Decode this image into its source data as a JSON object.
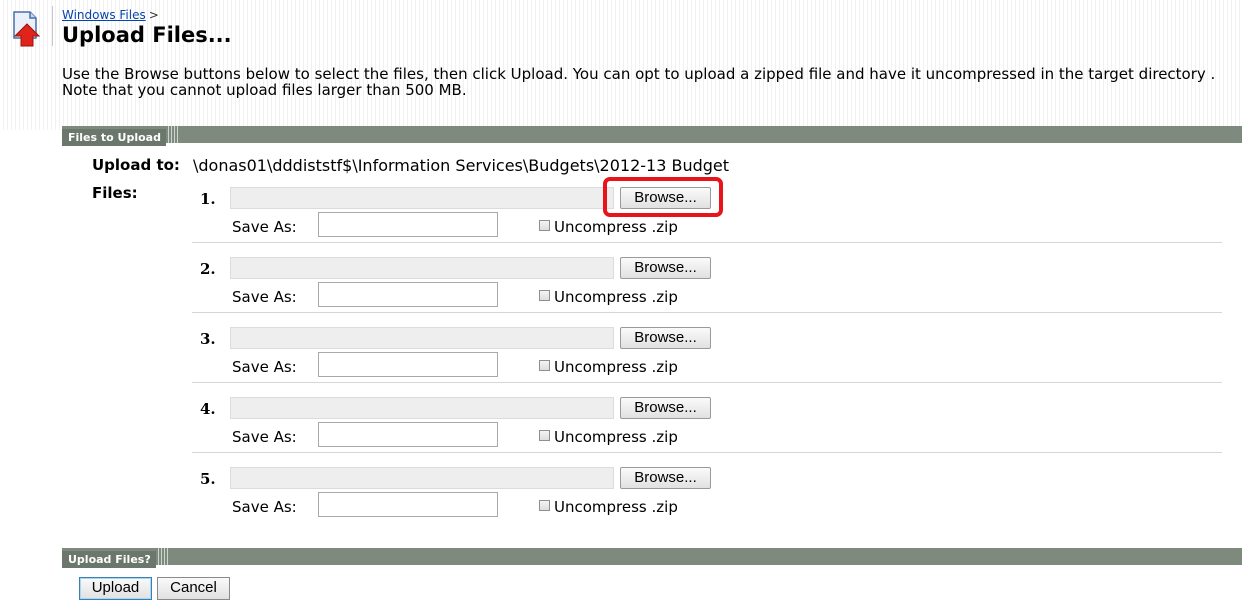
{
  "breadcrumb": {
    "link": "Windows Files",
    "separator": ">"
  },
  "page_title": "Upload Files...",
  "intro_text": "Use the Browse buttons below to select the files, then click Upload. You can opt to upload a zipped file and have it uncompressed in the target directory . Note that you cannot upload files larger than 500 MB.",
  "files_section": {
    "title": "Files to Upload",
    "upload_to_label": "Upload to:",
    "upload_to_path": "\\donas01\\dddiststf$\\Information Services\\Budgets\\2012-13 Budget",
    "files_label": "Files:",
    "rows": [
      {
        "num": "1.",
        "browse_label": "Browse...",
        "save_as_label": "Save As:",
        "save_as_value": "",
        "uncompress_label": "Uncompress .zip",
        "uncompress_checked": false
      },
      {
        "num": "2.",
        "browse_label": "Browse...",
        "save_as_label": "Save As:",
        "save_as_value": "",
        "uncompress_label": "Uncompress .zip",
        "uncompress_checked": false
      },
      {
        "num": "3.",
        "browse_label": "Browse...",
        "save_as_label": "Save As:",
        "save_as_value": "",
        "uncompress_label": "Uncompress .zip",
        "uncompress_checked": false
      },
      {
        "num": "4.",
        "browse_label": "Browse...",
        "save_as_label": "Save As:",
        "save_as_value": "",
        "uncompress_label": "Uncompress .zip",
        "uncompress_checked": false
      },
      {
        "num": "5.",
        "browse_label": "Browse...",
        "save_as_label": "Save As:",
        "save_as_value": "",
        "uncompress_label": "Uncompress .zip",
        "uncompress_checked": false
      }
    ]
  },
  "upload_section": {
    "title": "Upload Files?",
    "upload_label": "Upload",
    "cancel_label": "Cancel"
  },
  "colors": {
    "section_bar": "#7e8a7e",
    "link": "#0645ad",
    "highlight": "#e8141b"
  }
}
